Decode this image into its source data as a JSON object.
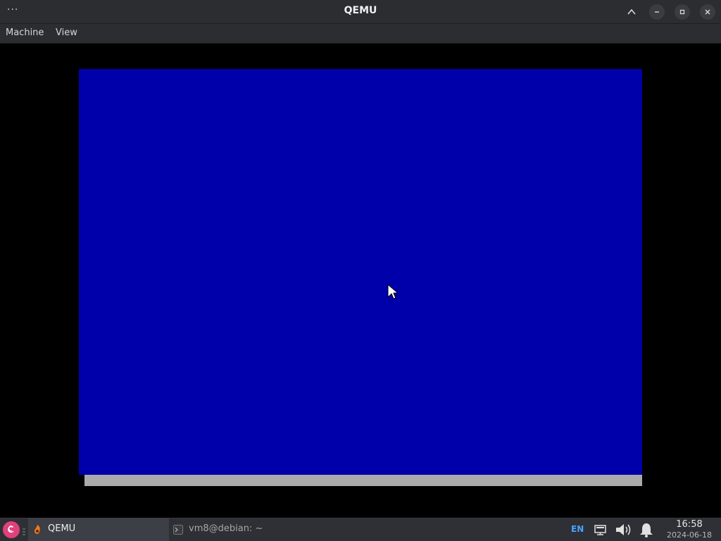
{
  "window": {
    "title": "QEMU",
    "menu_dots": "···",
    "icons": {
      "menu": "more-dots-icon",
      "keep_above": "chevron-up-icon",
      "minimize": "minimize-icon",
      "maximize": "maximize-icon",
      "close": "close-icon"
    }
  },
  "menubar": {
    "items": [
      {
        "label": "Machine"
      },
      {
        "label": "View"
      }
    ]
  },
  "vm": {
    "screen_color": "#0000aa",
    "statusbar_color": "#aaaaaa"
  },
  "taskbar": {
    "start_icon": "debian-swirl-icon",
    "tasks": [
      {
        "label": "QEMU",
        "icon": "qemu-icon",
        "active": true
      },
      {
        "label": "vm8@debian: ~",
        "icon": "terminal-icon",
        "active": false
      }
    ],
    "tray": {
      "language": "EN",
      "icons": [
        "network-icon",
        "volume-icon",
        "notification-bell-icon"
      ]
    },
    "clock": {
      "time": "16:58",
      "date": "2024-06-18"
    }
  },
  "colors": {
    "titlebar_bg": "#2b2d31",
    "taskbar_bg": "#2e3035",
    "accent_lang": "#4aa3ff",
    "start_button": "#e0417a"
  }
}
